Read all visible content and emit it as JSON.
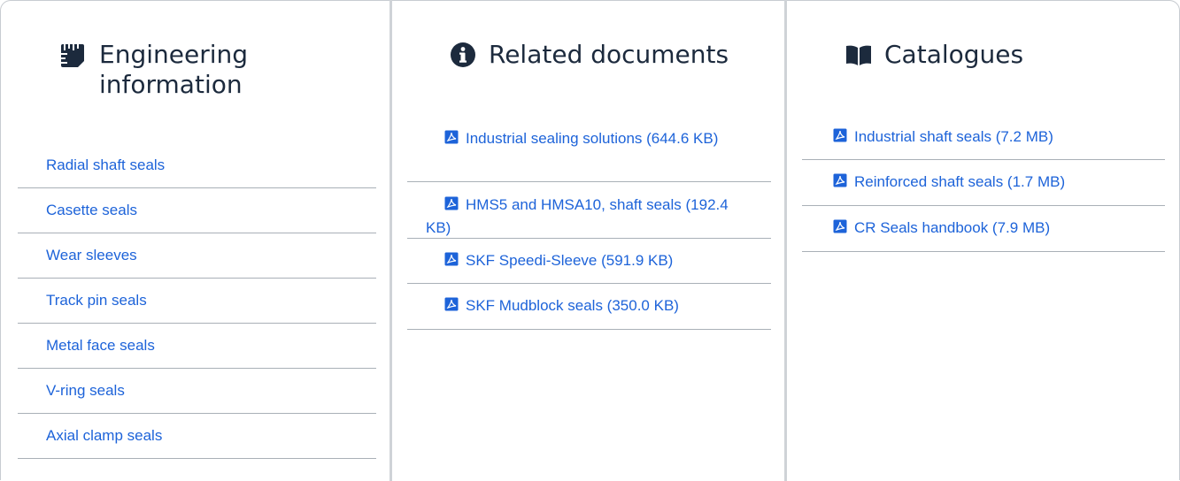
{
  "engineering": {
    "title_line1": "Engineering",
    "title_line2": "information",
    "items": [
      {
        "label": "Radial shaft seals"
      },
      {
        "label": "Casette seals"
      },
      {
        "label": "Wear sleeves"
      },
      {
        "label": "Track pin seals"
      },
      {
        "label": "Metal face seals"
      },
      {
        "label": "V-ring seals"
      },
      {
        "label": "Axial clamp seals"
      }
    ]
  },
  "related": {
    "title": "Related documents",
    "items": [
      {
        "label": "Industrial sealing solutions (644.6 KB)"
      },
      {
        "label": "HMS5 and HMSA10, shaft seals (192.4 KB)"
      },
      {
        "label": "SKF Speedi-Sleeve (591.9 KB)"
      },
      {
        "label": "SKF Mudblock seals (350.0 KB)"
      }
    ]
  },
  "catalogues": {
    "title": "Catalogues",
    "items": [
      {
        "label": "Industrial shaft seals (7.2 MB)"
      },
      {
        "label": "Reinforced shaft seals (1.7 MB)"
      },
      {
        "label": "CR Seals handbook (7.9 MB)"
      }
    ]
  },
  "colors": {
    "link": "#1d63d9",
    "heading": "#1c2a3d",
    "divider": "#a9b0b7",
    "pdf_icon": "#1d63d9"
  },
  "icons": {
    "engineering": "ruler-book-icon",
    "related": "info-circle-icon",
    "catalogues": "open-book-icon",
    "document": "pdf-file-icon"
  }
}
